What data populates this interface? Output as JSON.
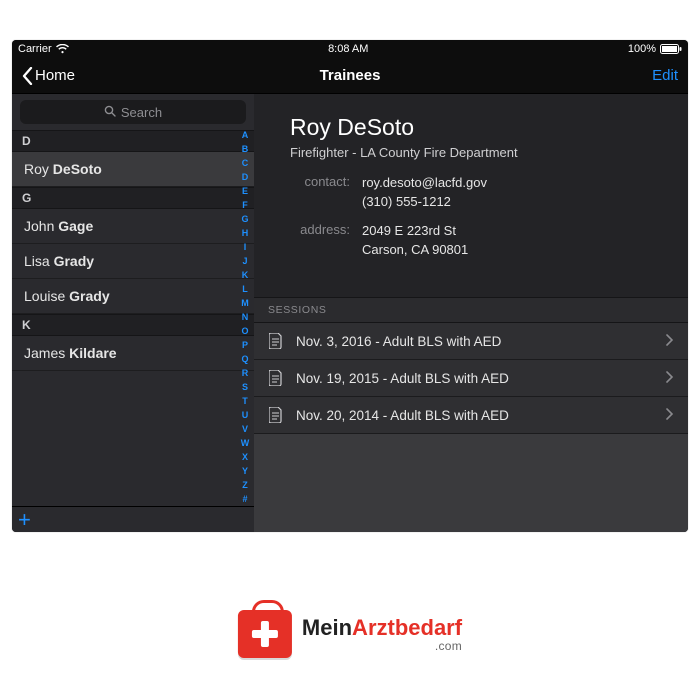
{
  "statusbar": {
    "carrier": "Carrier",
    "wifi_icon": "wifi-icon",
    "time": "8:08 AM",
    "battery_pct": "100%",
    "battery_icon": "battery-full-icon"
  },
  "navbar": {
    "back_label": "Home",
    "title": "Trainees",
    "edit_label": "Edit"
  },
  "sidebar": {
    "search_placeholder": "Search",
    "index_letters": [
      "A",
      "B",
      "C",
      "D",
      "E",
      "F",
      "G",
      "H",
      "I",
      "J",
      "K",
      "L",
      "M",
      "N",
      "O",
      "P",
      "Q",
      "R",
      "S",
      "T",
      "U",
      "V",
      "W",
      "X",
      "Y",
      "Z",
      "#"
    ],
    "sections": [
      {
        "letter": "D",
        "rows": [
          {
            "first": "Roy",
            "last": "DeSoto",
            "selected": true
          }
        ]
      },
      {
        "letter": "G",
        "rows": [
          {
            "first": "John",
            "last": "Gage",
            "selected": false
          },
          {
            "first": "Lisa",
            "last": "Grady",
            "selected": false
          },
          {
            "first": "Louise",
            "last": "Grady",
            "selected": false
          }
        ]
      },
      {
        "letter": "K",
        "rows": [
          {
            "first": "James",
            "last": "Kildare",
            "selected": false
          }
        ]
      }
    ],
    "add_icon": "plus-icon"
  },
  "detail": {
    "name": "Roy DeSoto",
    "subtitle": "Firefighter - LA County Fire Department",
    "contact_label": "contact:",
    "contact_email": "roy.desoto@lacfd.gov",
    "contact_phone": "(310) 555-1212",
    "address_label": "address:",
    "address_line1": "2049 E 223rd St",
    "address_line2": "Carson, CA 90801",
    "sessions_header": "SESSIONS",
    "sessions": [
      {
        "label": "Nov. 3, 2016 - Adult BLS with AED"
      },
      {
        "label": "Nov. 19, 2015 - Adult BLS with AED"
      },
      {
        "label": "Nov. 20, 2014 - Adult BLS with AED"
      }
    ]
  },
  "brand": {
    "text_main_pre": "Mein",
    "text_main_accent": "Arztbedarf",
    "text_dom": ".com"
  },
  "colors": {
    "accent_blue": "#1e90ff",
    "brand_red": "#e53027",
    "bg_dark": "#232326"
  }
}
